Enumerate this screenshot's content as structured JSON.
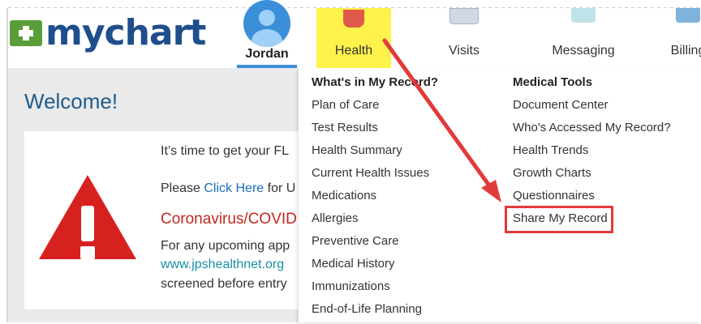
{
  "brand": {
    "logo_text": "mychart"
  },
  "user": {
    "name": "Jordan"
  },
  "nav": {
    "tabs": [
      {
        "label": "Health"
      },
      {
        "label": "Visits"
      },
      {
        "label": "Messaging"
      },
      {
        "label": "Billing"
      }
    ]
  },
  "welcome": "Welcome!",
  "notice": {
    "line1": "It’s time to get your FL",
    "line2_prefix": "Please ",
    "line2_link": "Click Here",
    "line2_suffix": " for U",
    "covid_title": "Coronavirus/COVID",
    "line3": "For any upcoming app",
    "web_link": "www.jpshealthnet.org",
    "line5": "screened before entry"
  },
  "menu": {
    "left": {
      "heading": "What's in My Record?",
      "items": [
        "Plan of Care",
        "Test Results",
        "Health Summary",
        "Current Health Issues",
        "Medications",
        "Allergies",
        "Preventive Care",
        "Medical History",
        "Immunizations",
        "End-of-Life Planning"
      ]
    },
    "right": {
      "heading": "Medical Tools",
      "items": [
        "Document Center",
        "Who's Accessed My Record?",
        "Health Trends",
        "Growth Charts",
        "Questionnaires",
        "Share My Record"
      ]
    }
  },
  "colors": {
    "brand_blue": "#1f4e8c",
    "health_tab_highlight": "#fff24a",
    "annotation_red": "#e23a3a",
    "warning_red": "#d6211f"
  },
  "icons": {
    "logo": "mychart-cross-logo",
    "avatar": "user-avatar-icon",
    "health": "heart-icon",
    "visits": "calendar-icon",
    "messaging": "envelope-icon",
    "billing": "card-icon",
    "warning": "warning-triangle-icon"
  }
}
